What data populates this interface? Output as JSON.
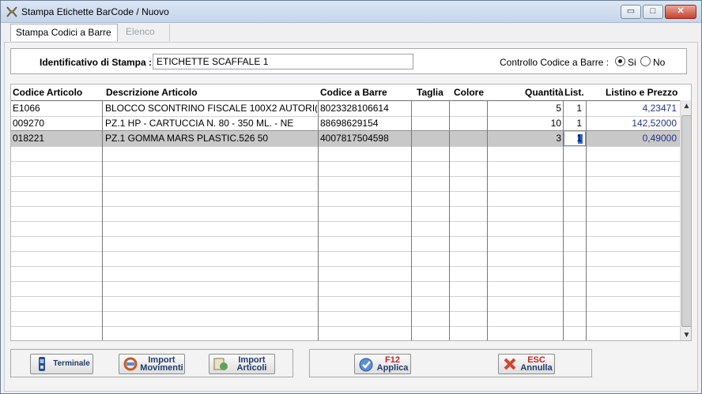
{
  "window": {
    "title": "Stampa Etichette BarCode / Nuovo",
    "controls": {
      "minimize": "▭",
      "maximize": "□",
      "close": "✕"
    }
  },
  "tabs": [
    {
      "label": "Stampa Codici a Barre",
      "active": true
    },
    {
      "label": "Elenco",
      "active": false
    }
  ],
  "identificativo": {
    "label": "Identificativo di Stampa :",
    "value": "ETICHETTE SCAFFALE 1"
  },
  "controllo": {
    "label": "Controllo Codice a Barre :",
    "options": [
      {
        "label": "Si",
        "selected": true
      },
      {
        "label": "No",
        "selected": false
      }
    ]
  },
  "table": {
    "columns": [
      "Codice Articolo",
      "Descrizione Articolo",
      "Codice a Barre",
      "Taglia",
      "Colore",
      "Quantità",
      "List.",
      "Listino e Prezzo"
    ],
    "rows": [
      {
        "codice": "E1066",
        "descrizione": "BLOCCO SCONTRINO FISCALE 100X2 AUTORI(",
        "barre": "8023328106614",
        "taglia": "",
        "colore": "",
        "quantita": "5",
        "list": "1",
        "prezzo": "4,23471",
        "selected": false
      },
      {
        "codice": "009270",
        "descrizione": "PZ.1 HP - CARTUCCIA N. 80 - 350 ML. - NE",
        "barre": "88698629154",
        "taglia": "",
        "colore": "",
        "quantita": "10",
        "list": "1",
        "prezzo": "142,52000",
        "selected": false
      },
      {
        "codice": "018221",
        "descrizione": "PZ.1 GOMMA MARS PLASTIC.526 50",
        "barre": "4007817504598",
        "taglia": "",
        "colore": "",
        "quantita": "3",
        "list": "1",
        "prezzo": "0,49000",
        "selected": true
      }
    ]
  },
  "buttons": {
    "terminale": "Terminale",
    "import_movimenti_1": "Import",
    "import_movimenti_2": "Movimenti",
    "import_articoli_1": "Import",
    "import_articoli_2": "Articoli",
    "applica_key": "F12",
    "applica_label": "Applica",
    "annulla_key": "ESC",
    "annulla_label": "Annulla"
  },
  "icons": {
    "app": "barcode-app-icon",
    "terminale": "handheld-terminal-icon",
    "import_movimenti": "import-movements-icon",
    "import_articoli": "import-articles-icon",
    "applica": "checkmark-icon",
    "annulla": "cross-icon"
  },
  "colors": {
    "price_text": "#25358a",
    "selected_row": "#c8c8c8",
    "key_label": "#cc2222"
  }
}
